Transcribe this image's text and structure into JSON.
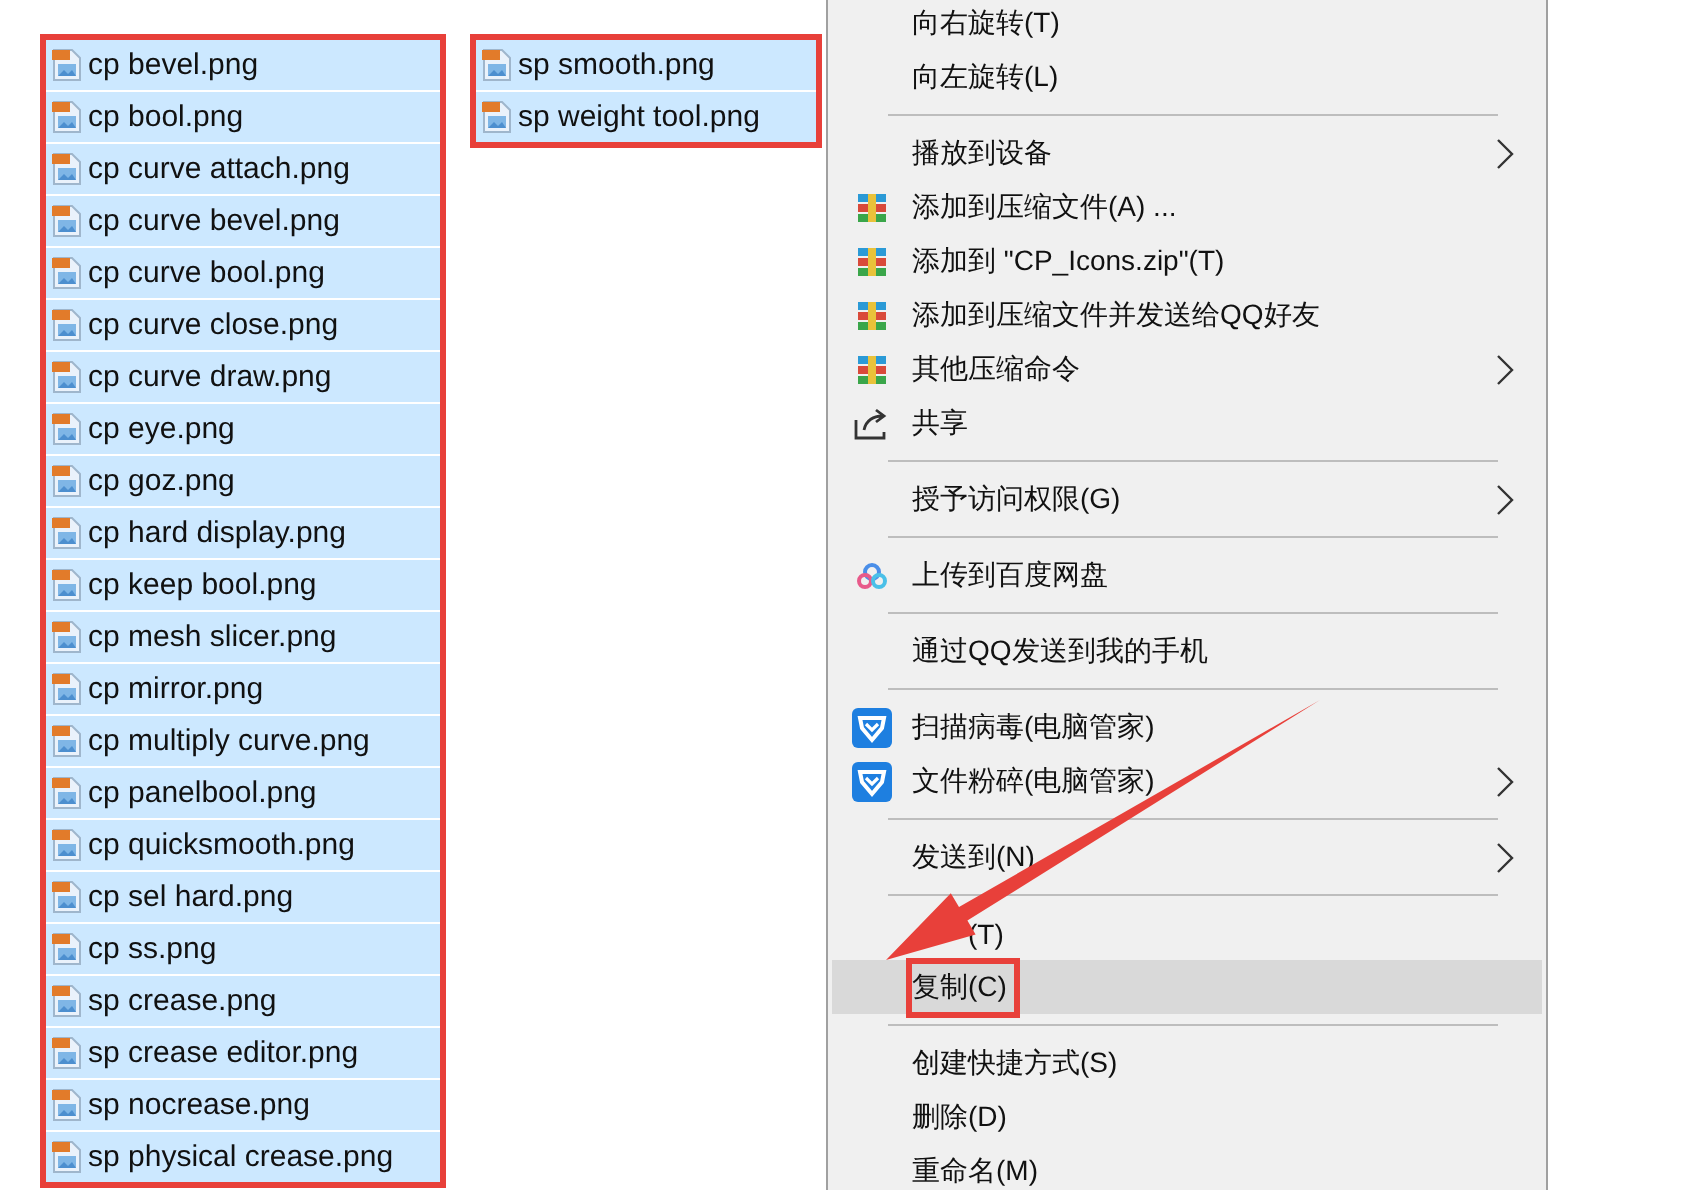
{
  "file_columns": [
    {
      "outlined": true,
      "files": [
        {
          "name": "cp bevel.png",
          "selected": true
        },
        {
          "name": "cp bool.png",
          "selected": true
        },
        {
          "name": "cp curve attach.png",
          "selected": true
        },
        {
          "name": "cp curve bevel.png",
          "selected": true
        },
        {
          "name": "cp curve bool.png",
          "selected": true
        },
        {
          "name": "cp curve close.png",
          "selected": true
        },
        {
          "name": "cp curve draw.png",
          "selected": true
        },
        {
          "name": "cp eye.png",
          "selected": true
        },
        {
          "name": "cp goz.png",
          "selected": true
        },
        {
          "name": "cp hard display.png",
          "selected": true
        },
        {
          "name": "cp keep bool.png",
          "selected": true
        },
        {
          "name": "cp mesh slicer.png",
          "selected": true
        },
        {
          "name": "cp mirror.png",
          "selected": true
        },
        {
          "name": "cp multiply curve.png",
          "selected": true
        },
        {
          "name": "cp panelbool.png",
          "selected": true
        },
        {
          "name": "cp quicksmooth.png",
          "selected": true
        },
        {
          "name": "cp sel hard.png",
          "selected": true
        },
        {
          "name": "cp ss.png",
          "selected": true
        },
        {
          "name": "sp crease.png",
          "selected": true
        },
        {
          "name": "sp crease editor.png",
          "selected": true
        },
        {
          "name": "sp nocrease.png",
          "selected": true
        },
        {
          "name": "sp physical crease.png",
          "selected": true
        }
      ]
    },
    {
      "outlined": true,
      "files": [
        {
          "name": "sp smooth.png",
          "selected": true
        },
        {
          "name": "sp weight tool.png",
          "selected": true
        }
      ]
    }
  ],
  "context_menu": {
    "items": [
      {
        "kind": "plain",
        "label": "向右旋转(T)",
        "selected": false,
        "outlined": false
      },
      {
        "kind": "plain",
        "label": "向左旋转(L)",
        "selected": false,
        "outlined": false
      },
      {
        "kind": "separator"
      },
      {
        "kind": "plain",
        "label": "播放到设备",
        "submenu": true,
        "selected": false,
        "outlined": false
      },
      {
        "kind": "archive",
        "label": "添加到压缩文件(A) ...",
        "selected": false,
        "outlined": false
      },
      {
        "kind": "archive",
        "label": "添加到 \"CP_Icons.zip\"(T)",
        "selected": false,
        "outlined": false
      },
      {
        "kind": "archive",
        "label": "添加到压缩文件并发送给QQ好友",
        "selected": false,
        "outlined": false
      },
      {
        "kind": "archive",
        "label": "其他压缩命令",
        "submenu": true,
        "selected": false,
        "outlined": false
      },
      {
        "kind": "share",
        "label": "共享",
        "selected": false,
        "outlined": false
      },
      {
        "kind": "separator"
      },
      {
        "kind": "plain",
        "label": "授予访问权限(G)",
        "submenu": true,
        "selected": false,
        "outlined": false
      },
      {
        "kind": "separator"
      },
      {
        "kind": "cloud",
        "label": "上传到百度网盘",
        "selected": false,
        "outlined": false
      },
      {
        "kind": "separator"
      },
      {
        "kind": "plain",
        "label": "通过QQ发送到我的手机",
        "selected": false,
        "outlined": false
      },
      {
        "kind": "separator"
      },
      {
        "kind": "shield",
        "label": "扫描病毒(电脑管家)",
        "selected": false,
        "outlined": false
      },
      {
        "kind": "shield",
        "label": "文件粉碎(电脑管家)",
        "submenu": true,
        "selected": false,
        "outlined": false
      },
      {
        "kind": "separator"
      },
      {
        "kind": "plain",
        "label": "发送到(N)",
        "submenu": true,
        "selected": false,
        "outlined": false
      },
      {
        "kind": "separator"
      },
      {
        "kind": "covered",
        "label": "(T)",
        "selected": false,
        "outlined": false
      },
      {
        "kind": "plain",
        "label": "复制(C)",
        "selected": true,
        "outlined": true
      },
      {
        "kind": "separator"
      },
      {
        "kind": "plain",
        "label": "创建快捷方式(S)",
        "selected": false,
        "outlined": false
      },
      {
        "kind": "plain",
        "label": "删除(D)",
        "selected": false,
        "outlined": false
      },
      {
        "kind": "plain",
        "label": "重命名(M)",
        "selected": false,
        "outlined": false
      }
    ]
  }
}
